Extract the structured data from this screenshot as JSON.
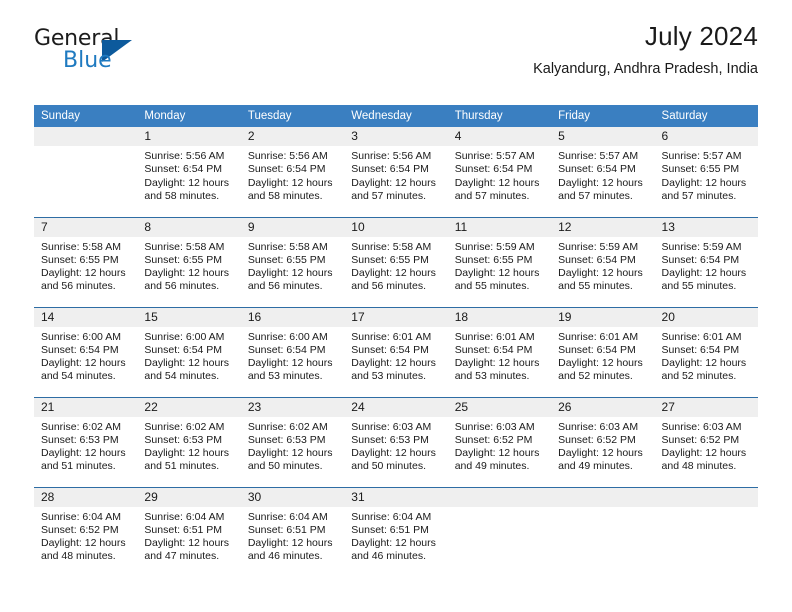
{
  "brand": {
    "name_part1": "General",
    "name_part2": "Blue"
  },
  "header": {
    "title": "July 2024",
    "location": "Kalyandurg, Andhra Pradesh, India"
  },
  "colors": {
    "header_blue": "#3a7fc1",
    "row_border_blue": "#2e6da4",
    "daynum_band": "#efefef",
    "brand_blue": "#1f7ac0",
    "brand_triangle": "#0d5a9c"
  },
  "weekday_headers": [
    "Sunday",
    "Monday",
    "Tuesday",
    "Wednesday",
    "Thursday",
    "Friday",
    "Saturday"
  ],
  "labels": {
    "sunrise_prefix": "Sunrise:",
    "sunset_prefix": "Sunset:",
    "daylight_prefix": "Daylight:"
  },
  "weeks": [
    [
      {
        "day": "",
        "sunrise": "",
        "sunset": "",
        "daylight": "",
        "empty": true
      },
      {
        "day": "1",
        "sunrise": "Sunrise: 5:56 AM",
        "sunset": "Sunset: 6:54 PM",
        "daylight": "Daylight: 12 hours and 58 minutes."
      },
      {
        "day": "2",
        "sunrise": "Sunrise: 5:56 AM",
        "sunset": "Sunset: 6:54 PM",
        "daylight": "Daylight: 12 hours and 58 minutes."
      },
      {
        "day": "3",
        "sunrise": "Sunrise: 5:56 AM",
        "sunset": "Sunset: 6:54 PM",
        "daylight": "Daylight: 12 hours and 57 minutes."
      },
      {
        "day": "4",
        "sunrise": "Sunrise: 5:57 AM",
        "sunset": "Sunset: 6:54 PM",
        "daylight": "Daylight: 12 hours and 57 minutes."
      },
      {
        "day": "5",
        "sunrise": "Sunrise: 5:57 AM",
        "sunset": "Sunset: 6:54 PM",
        "daylight": "Daylight: 12 hours and 57 minutes."
      },
      {
        "day": "6",
        "sunrise": "Sunrise: 5:57 AM",
        "sunset": "Sunset: 6:55 PM",
        "daylight": "Daylight: 12 hours and 57 minutes."
      }
    ],
    [
      {
        "day": "7",
        "sunrise": "Sunrise: 5:58 AM",
        "sunset": "Sunset: 6:55 PM",
        "daylight": "Daylight: 12 hours and 56 minutes."
      },
      {
        "day": "8",
        "sunrise": "Sunrise: 5:58 AM",
        "sunset": "Sunset: 6:55 PM",
        "daylight": "Daylight: 12 hours and 56 minutes."
      },
      {
        "day": "9",
        "sunrise": "Sunrise: 5:58 AM",
        "sunset": "Sunset: 6:55 PM",
        "daylight": "Daylight: 12 hours and 56 minutes."
      },
      {
        "day": "10",
        "sunrise": "Sunrise: 5:58 AM",
        "sunset": "Sunset: 6:55 PM",
        "daylight": "Daylight: 12 hours and 56 minutes."
      },
      {
        "day": "11",
        "sunrise": "Sunrise: 5:59 AM",
        "sunset": "Sunset: 6:55 PM",
        "daylight": "Daylight: 12 hours and 55 minutes."
      },
      {
        "day": "12",
        "sunrise": "Sunrise: 5:59 AM",
        "sunset": "Sunset: 6:54 PM",
        "daylight": "Daylight: 12 hours and 55 minutes."
      },
      {
        "day": "13",
        "sunrise": "Sunrise: 5:59 AM",
        "sunset": "Sunset: 6:54 PM",
        "daylight": "Daylight: 12 hours and 55 minutes."
      }
    ],
    [
      {
        "day": "14",
        "sunrise": "Sunrise: 6:00 AM",
        "sunset": "Sunset: 6:54 PM",
        "daylight": "Daylight: 12 hours and 54 minutes."
      },
      {
        "day": "15",
        "sunrise": "Sunrise: 6:00 AM",
        "sunset": "Sunset: 6:54 PM",
        "daylight": "Daylight: 12 hours and 54 minutes."
      },
      {
        "day": "16",
        "sunrise": "Sunrise: 6:00 AM",
        "sunset": "Sunset: 6:54 PM",
        "daylight": "Daylight: 12 hours and 53 minutes."
      },
      {
        "day": "17",
        "sunrise": "Sunrise: 6:01 AM",
        "sunset": "Sunset: 6:54 PM",
        "daylight": "Daylight: 12 hours and 53 minutes."
      },
      {
        "day": "18",
        "sunrise": "Sunrise: 6:01 AM",
        "sunset": "Sunset: 6:54 PM",
        "daylight": "Daylight: 12 hours and 53 minutes."
      },
      {
        "day": "19",
        "sunrise": "Sunrise: 6:01 AM",
        "sunset": "Sunset: 6:54 PM",
        "daylight": "Daylight: 12 hours and 52 minutes."
      },
      {
        "day": "20",
        "sunrise": "Sunrise: 6:01 AM",
        "sunset": "Sunset: 6:54 PM",
        "daylight": "Daylight: 12 hours and 52 minutes."
      }
    ],
    [
      {
        "day": "21",
        "sunrise": "Sunrise: 6:02 AM",
        "sunset": "Sunset: 6:53 PM",
        "daylight": "Daylight: 12 hours and 51 minutes."
      },
      {
        "day": "22",
        "sunrise": "Sunrise: 6:02 AM",
        "sunset": "Sunset: 6:53 PM",
        "daylight": "Daylight: 12 hours and 51 minutes."
      },
      {
        "day": "23",
        "sunrise": "Sunrise: 6:02 AM",
        "sunset": "Sunset: 6:53 PM",
        "daylight": "Daylight: 12 hours and 50 minutes."
      },
      {
        "day": "24",
        "sunrise": "Sunrise: 6:03 AM",
        "sunset": "Sunset: 6:53 PM",
        "daylight": "Daylight: 12 hours and 50 minutes."
      },
      {
        "day": "25",
        "sunrise": "Sunrise: 6:03 AM",
        "sunset": "Sunset: 6:52 PM",
        "daylight": "Daylight: 12 hours and 49 minutes."
      },
      {
        "day": "26",
        "sunrise": "Sunrise: 6:03 AM",
        "sunset": "Sunset: 6:52 PM",
        "daylight": "Daylight: 12 hours and 49 minutes."
      },
      {
        "day": "27",
        "sunrise": "Sunrise: 6:03 AM",
        "sunset": "Sunset: 6:52 PM",
        "daylight": "Daylight: 12 hours and 48 minutes."
      }
    ],
    [
      {
        "day": "28",
        "sunrise": "Sunrise: 6:04 AM",
        "sunset": "Sunset: 6:52 PM",
        "daylight": "Daylight: 12 hours and 48 minutes."
      },
      {
        "day": "29",
        "sunrise": "Sunrise: 6:04 AM",
        "sunset": "Sunset: 6:51 PM",
        "daylight": "Daylight: 12 hours and 47 minutes."
      },
      {
        "day": "30",
        "sunrise": "Sunrise: 6:04 AM",
        "sunset": "Sunset: 6:51 PM",
        "daylight": "Daylight: 12 hours and 46 minutes."
      },
      {
        "day": "31",
        "sunrise": "Sunrise: 6:04 AM",
        "sunset": "Sunset: 6:51 PM",
        "daylight": "Daylight: 12 hours and 46 minutes."
      },
      {
        "day": "",
        "sunrise": "",
        "sunset": "",
        "daylight": "",
        "empty": true
      },
      {
        "day": "",
        "sunrise": "",
        "sunset": "",
        "daylight": "",
        "empty": true
      },
      {
        "day": "",
        "sunrise": "",
        "sunset": "",
        "daylight": "",
        "empty": true
      }
    ]
  ]
}
